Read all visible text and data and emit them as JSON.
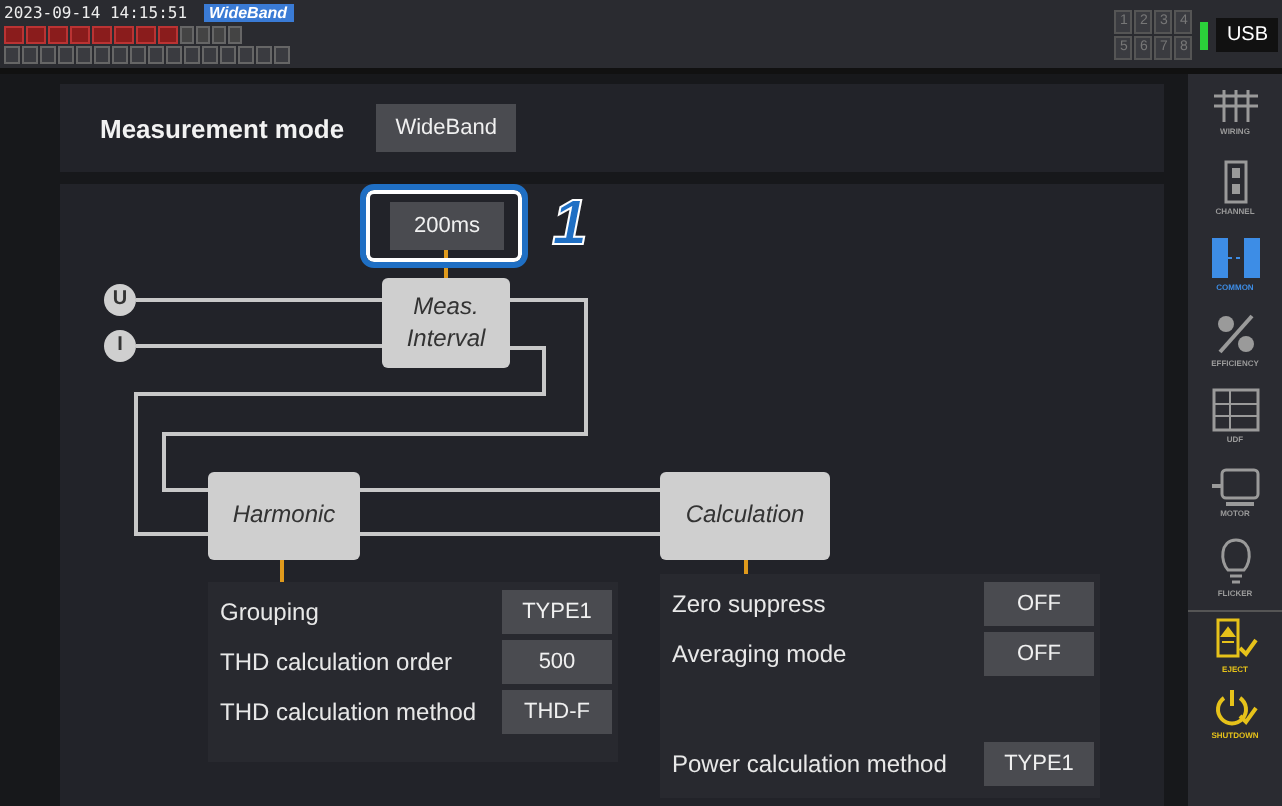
{
  "status_bar": {
    "datetime": "2023-09-14 14:15:51",
    "mode_badge": "WideBand",
    "slot_numbers": [
      "1",
      "2",
      "3",
      "4",
      "5",
      "6",
      "7",
      "8"
    ],
    "storage": "USB"
  },
  "measurement_mode": {
    "label": "Measurement mode",
    "value": "WideBand"
  },
  "diagram": {
    "interval_value": "200ms",
    "callout": "1",
    "inputs": [
      "U",
      "I"
    ],
    "blocks": {
      "interval": "Meas.\nInterval",
      "harmonic": "Harmonic",
      "calculation": "Calculation"
    },
    "harmonic_settings": [
      {
        "label": "Grouping",
        "value": "TYPE1"
      },
      {
        "label": "THD calculation order",
        "value": "500"
      },
      {
        "label": "THD calculation method",
        "value": "THD-F"
      }
    ],
    "calculation_settings": [
      {
        "label": "Zero suppress",
        "value": "OFF"
      },
      {
        "label": "Averaging mode",
        "value": "OFF"
      },
      {
        "label": "Power calculation method",
        "value": "TYPE1"
      }
    ]
  },
  "sidebar": [
    {
      "kind": "wiring",
      "label": "WIRING",
      "selected": false
    },
    {
      "kind": "channel",
      "label": "CHANNEL",
      "selected": false
    },
    {
      "kind": "common",
      "label": "COMMON",
      "selected": true
    },
    {
      "kind": "efficiency",
      "label": "EFFICIENCY",
      "selected": false
    },
    {
      "kind": "udf",
      "label": "UDF",
      "selected": false
    },
    {
      "kind": "motor",
      "label": "MOTOR",
      "selected": false
    },
    {
      "kind": "flicker",
      "label": "FLICKER",
      "selected": false
    },
    {
      "kind": "eject",
      "label": "EJECT",
      "selected": false
    },
    {
      "kind": "shutdown",
      "label": "SHUTDOWN",
      "selected": false
    }
  ]
}
